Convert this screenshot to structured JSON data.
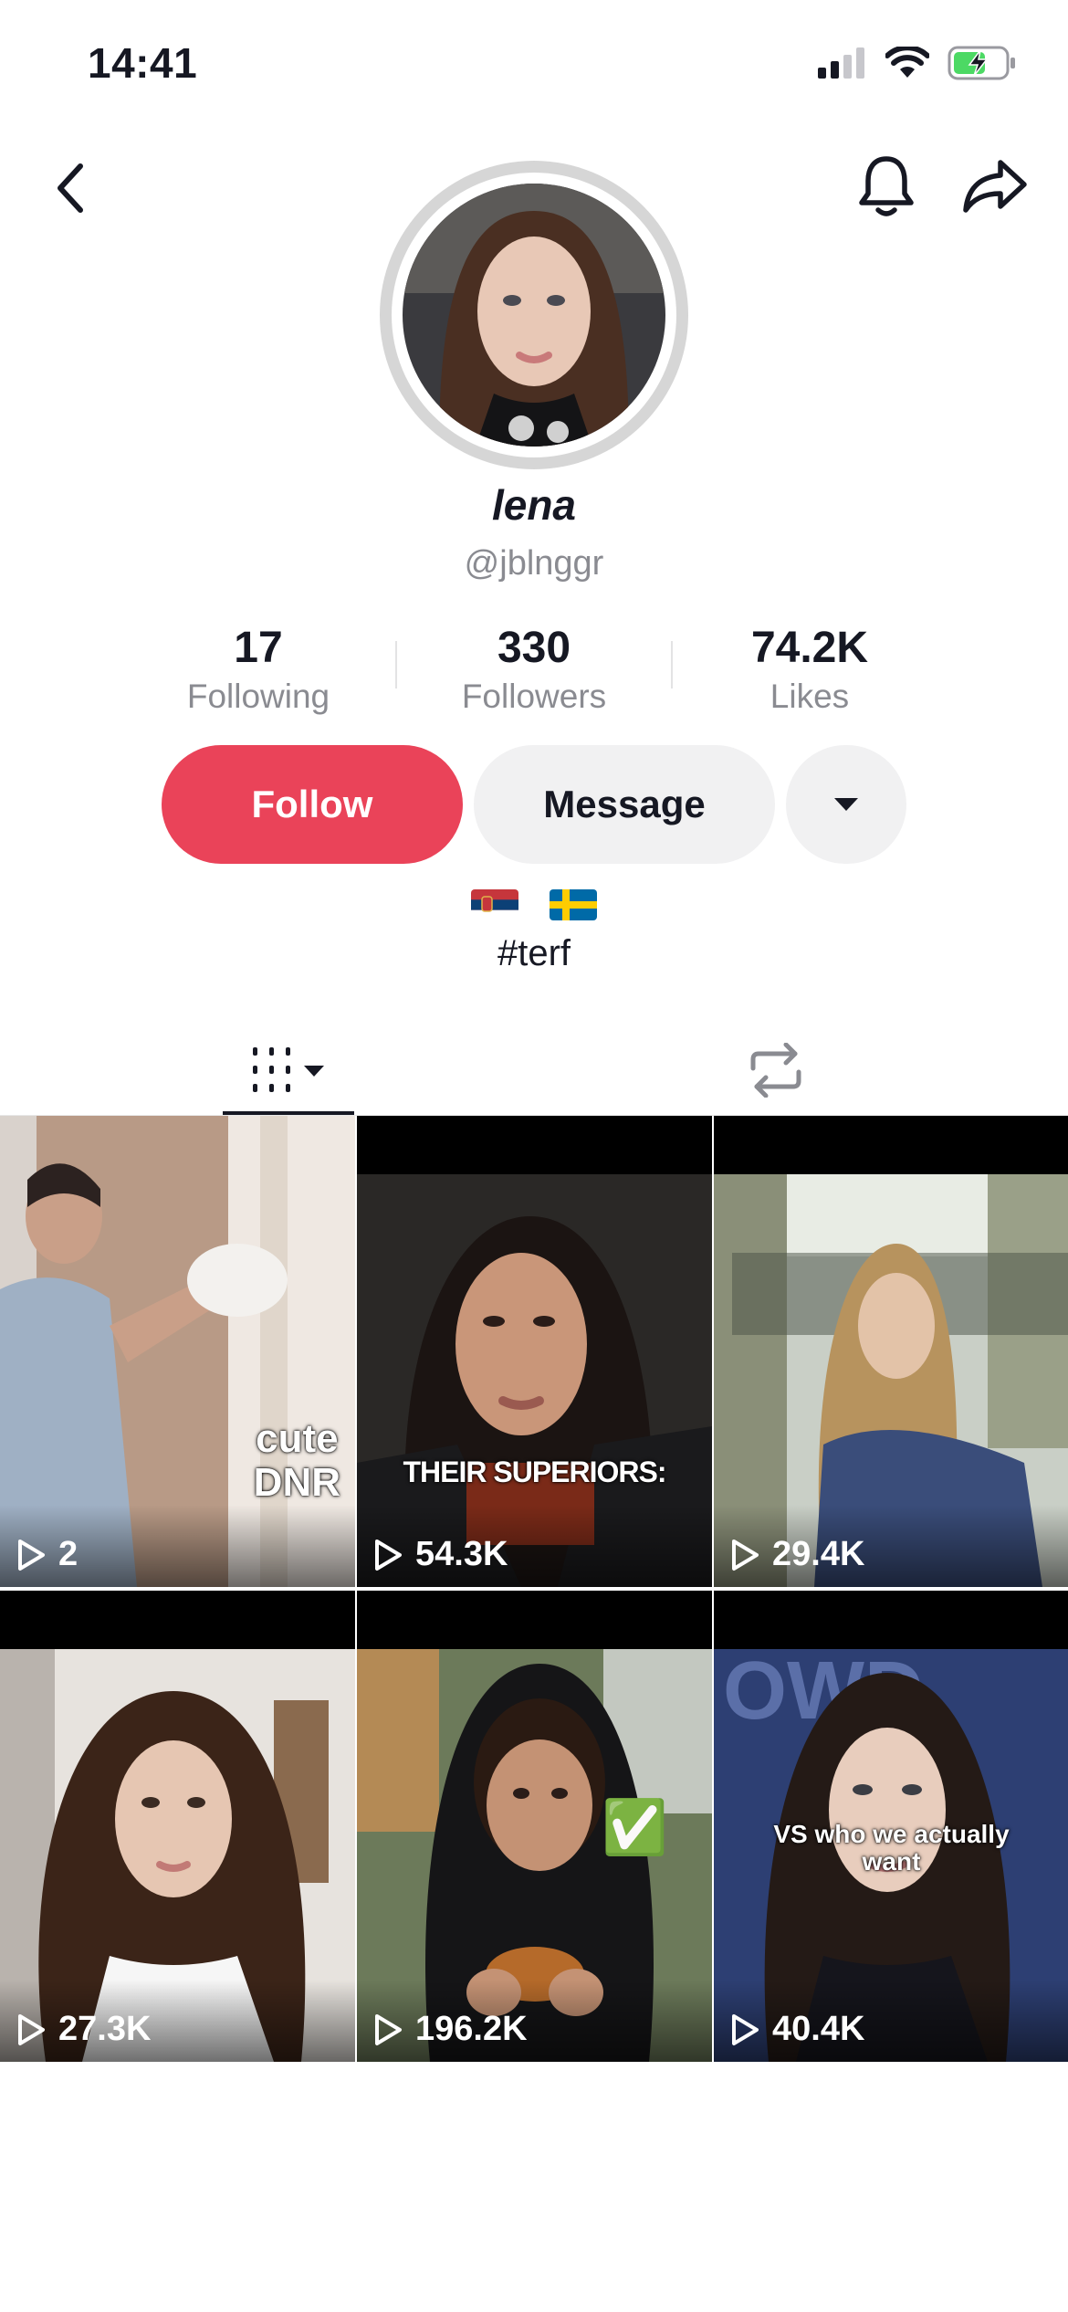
{
  "status_bar": {
    "time": "14:41"
  },
  "profile": {
    "display_name": "lena",
    "username": "@jblnggr",
    "stats": [
      {
        "value": "17",
        "label": "Following"
      },
      {
        "value": "330",
        "label": "Followers"
      },
      {
        "value": "74.2K",
        "label": "Likes"
      }
    ],
    "bio_flags": [
      "🇷🇸",
      "🇸🇪"
    ],
    "bio": "#terf"
  },
  "actions": {
    "follow_label": "Follow",
    "message_label": "Message"
  },
  "colors": {
    "accent": "#ea4359",
    "secondary_button": "#f1f1f2",
    "muted_text": "#8a8b91"
  },
  "tabs": [
    {
      "icon": "grid-icon",
      "selected": true
    },
    {
      "icon": "repost-icon",
      "selected": false
    }
  ],
  "videos": [
    {
      "views": "2",
      "overlay": [
        "cute",
        "DNR"
      ]
    },
    {
      "views": "54.3K",
      "overlay": [
        "THEIR SUPERIORS:"
      ]
    },
    {
      "views": "29.4K",
      "overlay": []
    },
    {
      "views": "27.3K",
      "overlay": []
    },
    {
      "views": "196.2K",
      "overlay": [
        "✅"
      ]
    },
    {
      "views": "40.4K",
      "overlay": [
        "VS who we actually",
        "want"
      ]
    }
  ]
}
